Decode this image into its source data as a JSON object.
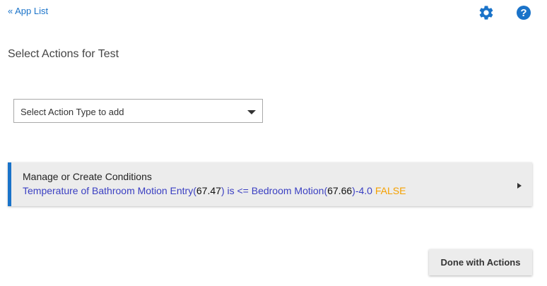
{
  "header": {
    "back_link": "« App List",
    "settings_icon": "gear-icon",
    "help_icon": "question-circle-icon"
  },
  "page_title": "Select Actions for Test",
  "action_select": {
    "selected_value": "Select Action Type to add"
  },
  "conditions_panel": {
    "title": "Manage or Create Conditions",
    "summary": {
      "part1": "Temperature of Bathroom Motion Entry(",
      "value1": "67.47",
      "part2": ") is <= Bedroom Motion(",
      "value2": "67.66",
      "part3": ")-4.0 ",
      "result": "FALSE"
    }
  },
  "footer": {
    "done_label": "Done with Actions"
  },
  "colors": {
    "accent": "#1a73c9",
    "condition_text": "#3a3fc2",
    "false_result": "#f5a000"
  }
}
